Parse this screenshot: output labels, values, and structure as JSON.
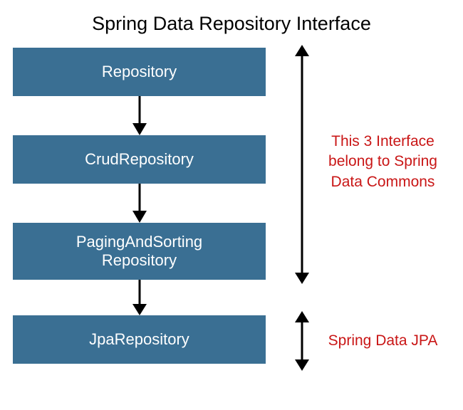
{
  "title": "Spring Data Repository Interface",
  "boxes": {
    "repository": "Repository",
    "crud": "CrudRepository",
    "paging_line1": "PagingAndSorting",
    "paging_line2": "Repository",
    "jpa": "JpaRepository"
  },
  "annotations": {
    "commons_line1": "This 3 Interface",
    "commons_line2": "belong to Spring",
    "commons_line3": "Data Commons",
    "jpa": "Spring Data JPA"
  },
  "colors": {
    "box_bg": "#3a6f93",
    "box_text": "#ffffff",
    "annotation": "#c91616",
    "arrow": "#000000"
  }
}
